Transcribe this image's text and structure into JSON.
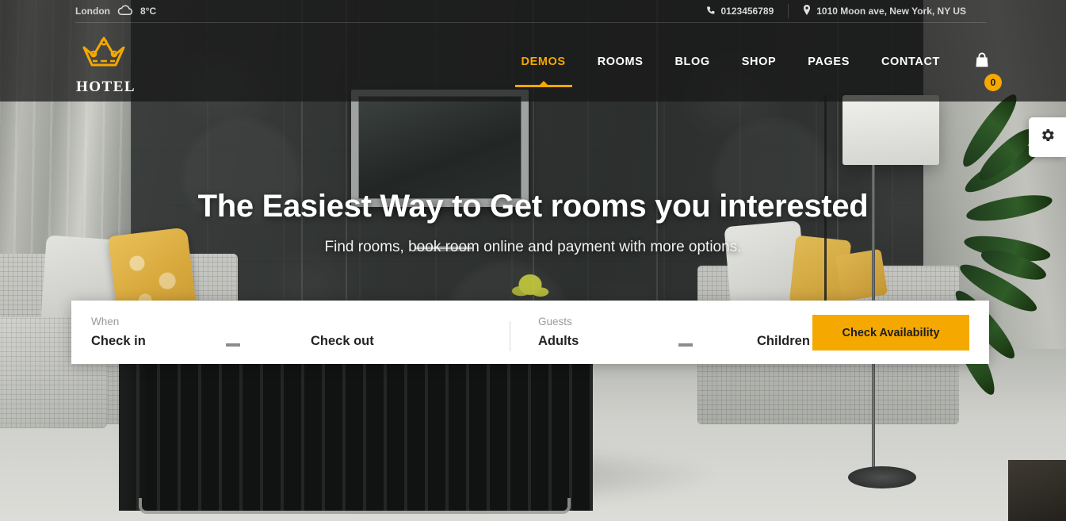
{
  "topbar": {
    "city": "London",
    "weather_icon": "cloud-icon",
    "temperature": "8°C",
    "phone_icon": "phone-icon",
    "phone": "0123456789",
    "location_icon": "map-pin-icon",
    "address": "1010 Moon ave, New York, NY US"
  },
  "brand": {
    "logo_icon": "crown-icon",
    "name": "HOTEL"
  },
  "nav": {
    "items": [
      {
        "label": "DEMOS",
        "active": true
      },
      {
        "label": "ROOMS",
        "active": false
      },
      {
        "label": "BLOG",
        "active": false
      },
      {
        "label": "SHOP",
        "active": false
      },
      {
        "label": "PAGES",
        "active": false
      },
      {
        "label": "CONTACT",
        "active": false
      }
    ],
    "cart_icon": "shopping-bag-icon",
    "cart_count": "0"
  },
  "hero": {
    "title": "The Easiest Way to Get rooms you interested",
    "subtitle": "Find rooms, book room online and payment with more options."
  },
  "booking": {
    "when_label": "When",
    "check_in": "Check in",
    "check_out": "Check out",
    "guests_label": "Guests",
    "adults": "Adults",
    "children": "Children",
    "submit_label": "Check Availability"
  },
  "settings": {
    "icon": "gear-icon"
  },
  "colors": {
    "accent_gold": "#f5a800",
    "header_overlay": "rgba(22,22,22,0.72)",
    "card_bg": "#ffffff",
    "text_dark": "#232323",
    "label_gray": "#9a9a9a"
  }
}
